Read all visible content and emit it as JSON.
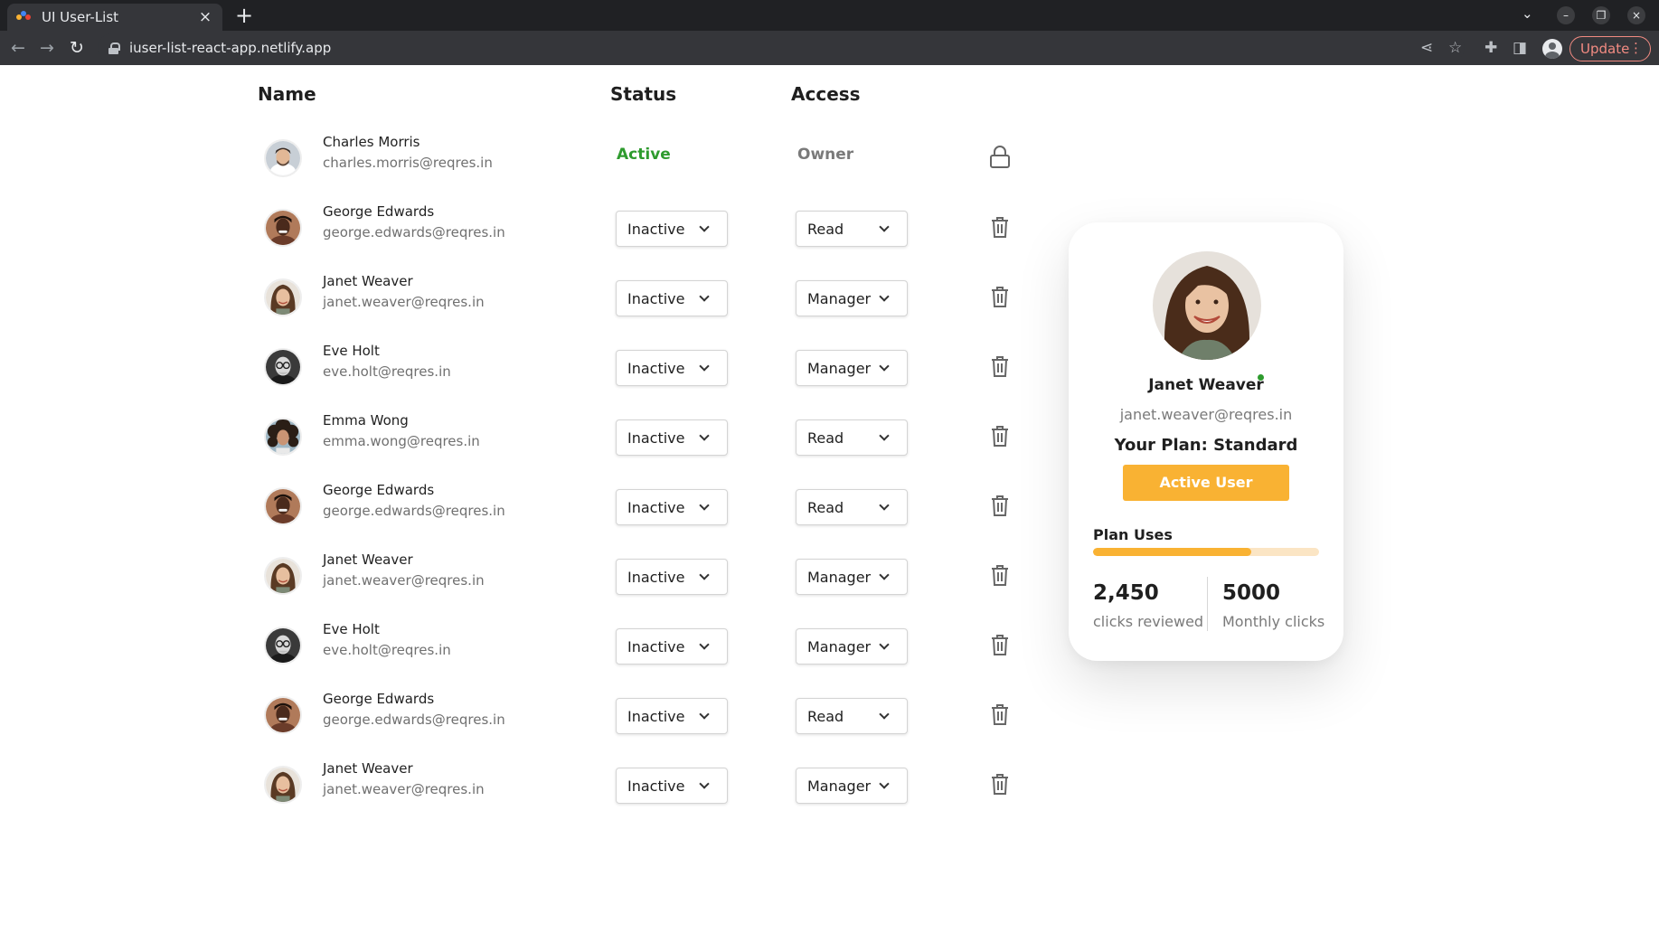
{
  "browser": {
    "tab_title": "UI User-List",
    "url": "iuser-list-react-app.netlify.app",
    "update_label": "Update"
  },
  "table": {
    "headers": {
      "name": "Name",
      "status": "Status",
      "access": "Access"
    },
    "rows": [
      {
        "name": "Charles Morris",
        "email": "charles.morris@reqres.in",
        "status": "Active",
        "access": "Owner",
        "action_icon": "lock-icon",
        "avatar": "man-light-beard"
      },
      {
        "name": "George Edwards",
        "email": "george.edwards@reqres.in",
        "status": "Inactive",
        "access": "Read",
        "action_icon": "trash-icon",
        "avatar": "man-dark-skin"
      },
      {
        "name": "Janet Weaver",
        "email": "janet.weaver@reqres.in",
        "status": "Inactive",
        "access": "Manager",
        "action_icon": "trash-icon",
        "avatar": "woman-brown-hair"
      },
      {
        "name": "Eve Holt",
        "email": "eve.holt@reqres.in",
        "status": "Inactive",
        "access": "Manager",
        "action_icon": "trash-icon",
        "avatar": "man-bald-glasses"
      },
      {
        "name": "Emma Wong",
        "email": "emma.wong@reqres.in",
        "status": "Inactive",
        "access": "Read",
        "action_icon": "trash-icon",
        "avatar": "woman-curly-hair"
      },
      {
        "name": "George Edwards",
        "email": "george.edwards@reqres.in",
        "status": "Inactive",
        "access": "Read",
        "action_icon": "trash-icon",
        "avatar": "man-dark-skin"
      },
      {
        "name": "Janet Weaver",
        "email": "janet.weaver@reqres.in",
        "status": "Inactive",
        "access": "Manager",
        "action_icon": "trash-icon",
        "avatar": "woman-brown-hair"
      },
      {
        "name": "Eve Holt",
        "email": "eve.holt@reqres.in",
        "status": "Inactive",
        "access": "Manager",
        "action_icon": "trash-icon",
        "avatar": "man-bald-glasses"
      },
      {
        "name": "George Edwards",
        "email": "george.edwards@reqres.in",
        "status": "Inactive",
        "access": "Read",
        "action_icon": "trash-icon",
        "avatar": "man-dark-skin"
      },
      {
        "name": "Janet Weaver",
        "email": "janet.weaver@reqres.in",
        "status": "Inactive",
        "access": "Manager",
        "action_icon": "trash-icon",
        "avatar": "woman-brown-hair"
      }
    ]
  },
  "card": {
    "name": "Janet Weaver",
    "email": "janet.weaver@reqres.in",
    "plan": "Your Plan: Standard",
    "button_label": "Active User",
    "plan_uses_label": "Plan Uses",
    "progress_fraction": 0.7,
    "stat1_value": "2,450",
    "stat1_label": "clicks reviewed",
    "stat2_value": "5000",
    "stat2_label": "Monthly clicks"
  },
  "colors": {
    "active_green": "#2e9b2e",
    "accent_orange": "#f9b233",
    "chrome_dark": "#202124"
  }
}
